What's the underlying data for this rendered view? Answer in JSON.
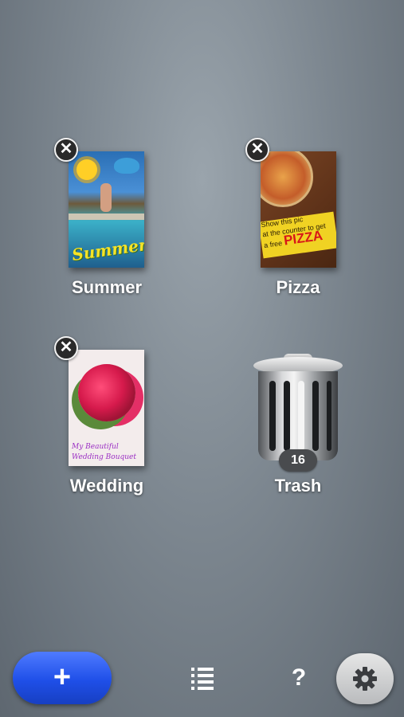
{
  "items": [
    {
      "id": "summer",
      "label": "Summer",
      "delete_icon": "close-icon",
      "thumbnail_text": "Summer"
    },
    {
      "id": "pizza",
      "label": "Pizza",
      "delete_icon": "close-icon",
      "thumbnail_text": [
        "Show this pic",
        "at the counter to get",
        "a free",
        "PIZZA"
      ]
    },
    {
      "id": "wedding",
      "label": "Wedding",
      "delete_icon": "close-icon",
      "thumbnail_text": [
        "My Beautiful",
        "Wedding Bouquet"
      ]
    }
  ],
  "trash": {
    "label": "Trash",
    "count": "16",
    "icon": "trash-can-icon"
  },
  "toolbar": {
    "add_label": "+",
    "list_icon": "list-icon",
    "help_label": "?",
    "settings_icon": "gear-icon"
  },
  "colors": {
    "add_button": "#2a55f0",
    "background": "#7d8790",
    "label": "#ffffff"
  }
}
